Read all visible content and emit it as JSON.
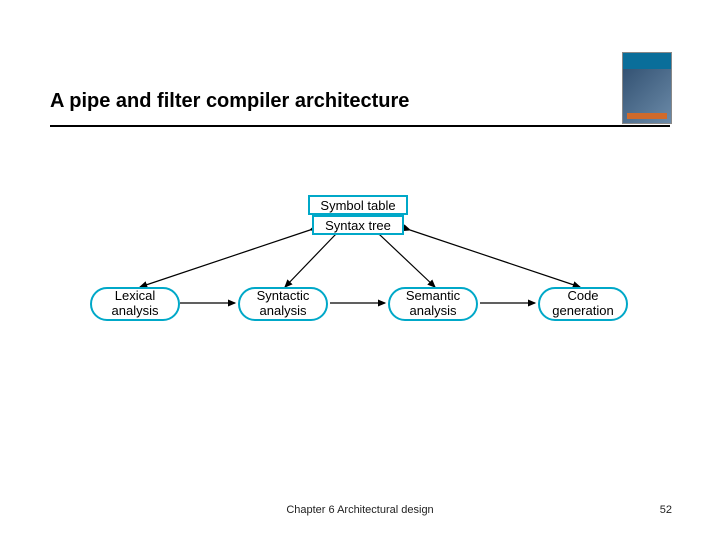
{
  "slide": {
    "title": "A pipe and filter compiler architecture",
    "footer_text": "Chapter 6 Architectural design",
    "page_number": "52"
  },
  "diagram": {
    "top_boxes": [
      {
        "label": "Symbol table"
      },
      {
        "label": "Syntax tree"
      }
    ],
    "stages": [
      {
        "label": "Lexical\nanalysis"
      },
      {
        "label": "Syntactic\nanalysis"
      },
      {
        "label": "Semantic\nanalysis"
      },
      {
        "label": "Code\ngeneration"
      }
    ]
  },
  "thumbnail": {
    "alt": "book-cover"
  }
}
